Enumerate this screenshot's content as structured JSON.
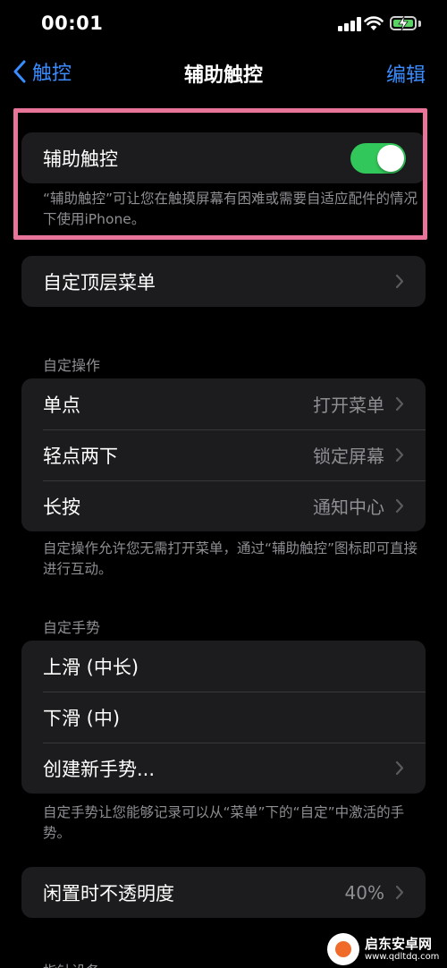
{
  "status_bar": {
    "time": "00:01"
  },
  "nav": {
    "back_label": "触控",
    "title": "辅助触控",
    "edit_label": "编辑"
  },
  "assistive_touch": {
    "label": "辅助触控",
    "enabled": true,
    "description": "“辅助触控”可让您在触摸屏幕有困难或需要自适应配件的情况下使用iPhone。"
  },
  "top_menu": {
    "label": "自定顶层菜单"
  },
  "custom_actions": {
    "header": "自定操作",
    "items": [
      {
        "label": "单点",
        "value": "打开菜单"
      },
      {
        "label": "轻点两下",
        "value": "锁定屏幕"
      },
      {
        "label": "长按",
        "value": "通知中心"
      }
    ],
    "footer": "自定操作允许您无需打开菜单，通过“辅助触控”图标即可直接进行互动。"
  },
  "custom_gestures": {
    "header": "自定手势",
    "items": [
      {
        "label": "上滑 (中长)"
      },
      {
        "label": "下滑 (中)"
      },
      {
        "label": "创建新手势..."
      }
    ],
    "footer": "自定手势让您能够记录可以从“菜单”下的“自定”中激活的手势。"
  },
  "idle_opacity": {
    "label": "闲置时不透明度",
    "value": "40%"
  },
  "next_section": {
    "header": "指针设备"
  },
  "watermark": {
    "name": "启东安卓网",
    "url": "www.qdltdq.com"
  },
  "colors": {
    "background": "#000000",
    "cell": "#1c1c1e",
    "accent_blue": "#3a8dff",
    "toggle_on": "#32c75a",
    "secondary_text": "#8e8e93",
    "highlight_border": "#e8749a",
    "battery_charging": "#5ad364"
  },
  "icons": [
    "signal-icon",
    "wifi-icon",
    "battery-charging-icon",
    "back-chevron-icon",
    "chevron-right-icon"
  ]
}
